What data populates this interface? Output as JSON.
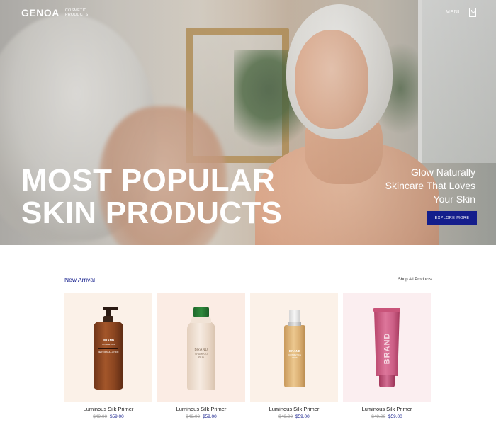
{
  "header": {
    "brand": "GENOA",
    "tagline": "COSMETIC PRODUCTS",
    "menu_label": "MENU"
  },
  "hero": {
    "title_line1": "MOST POPULAR",
    "title_line2": "SKIN PRODUCTS",
    "tagline_line1": "Glow Naturally",
    "tagline_line2": "Skincare That Loves",
    "tagline_line3": "Your Skin",
    "cta_label": "EXPLORE MORE"
  },
  "section": {
    "title": "New Arrival",
    "link_label": "Shop All Products"
  },
  "products": [
    {
      "name": "Luminous Silk Primer",
      "old_price": "$49.00",
      "price": "$59.00",
      "bg": "#fbf1e8",
      "label_lines": [
        "BRAND",
        "COSMETICS",
        "NEW FORMULA LOTION"
      ]
    },
    {
      "name": "Luminous Silk Primer",
      "old_price": "$49.00",
      "price": "$59.00",
      "bg": "#fbece4",
      "label_lines": [
        "BRAND",
        "SHAMPOO",
        "250 ML"
      ]
    },
    {
      "name": "Luminous Silk Primer",
      "old_price": "$49.00",
      "price": "$59.00",
      "bg": "#fbf1e8",
      "label_lines": [
        "BRAND",
        "COSMETICS",
        "100 ML"
      ]
    },
    {
      "name": "Luminous Silk Primer",
      "old_price": "$49.00",
      "price": "$59.00",
      "bg": "#fbeef0",
      "label_lines": [
        "BRAND"
      ]
    }
  ],
  "colors": {
    "accent": "#141e8c",
    "hero_text": "#ffffff",
    "price_old": "#a0a0a0"
  },
  "icons": {
    "cart": "shopping-bag-icon"
  }
}
